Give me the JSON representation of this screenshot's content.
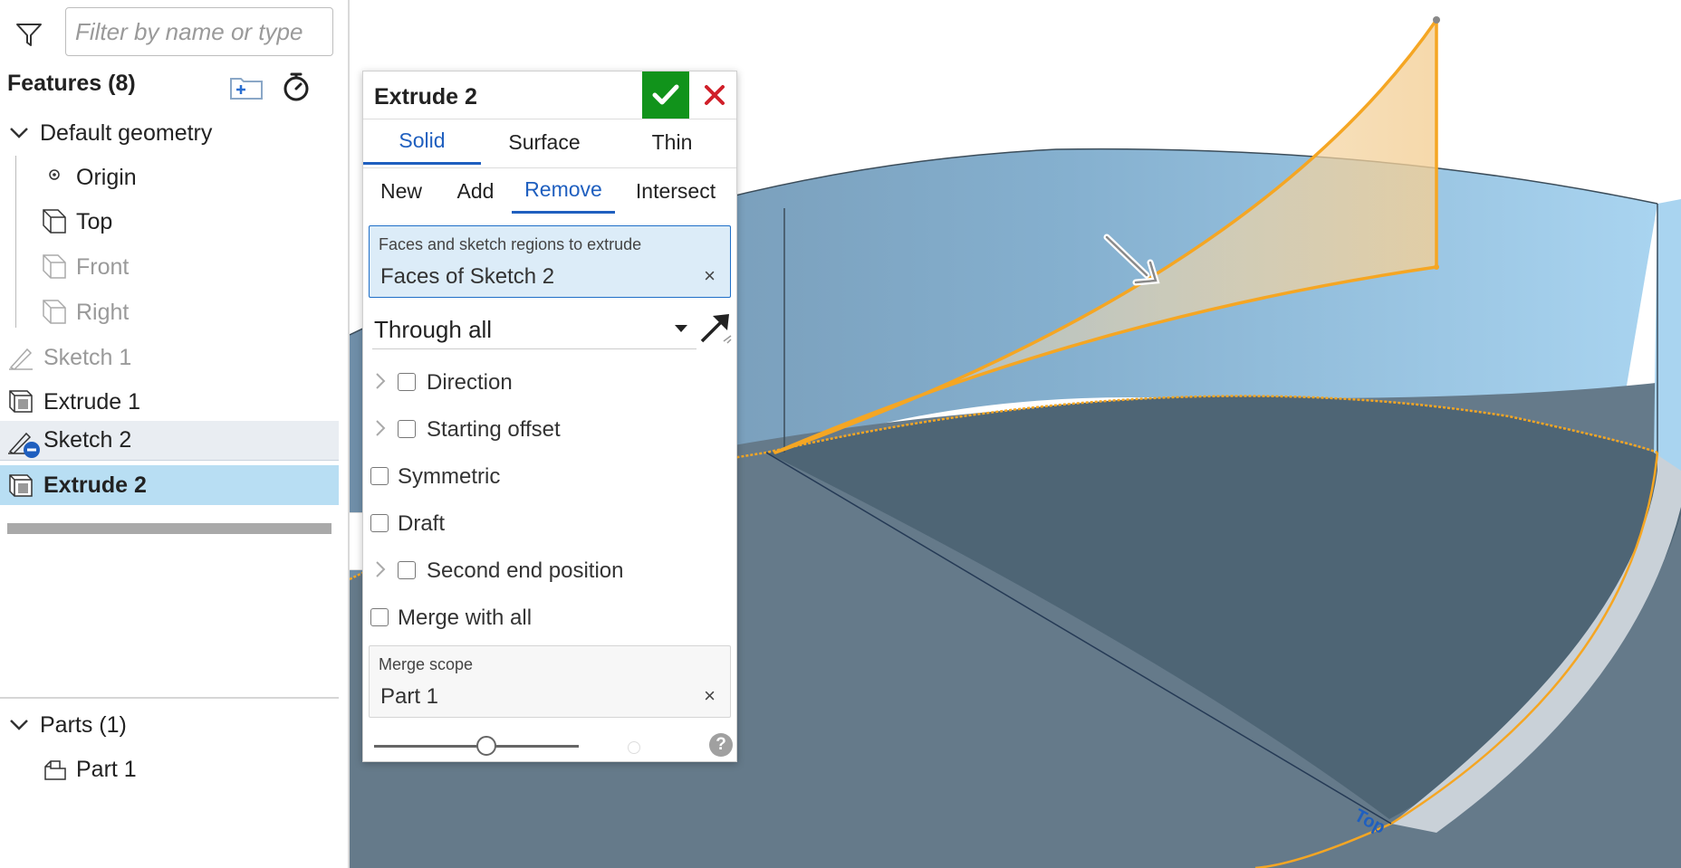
{
  "filter": {
    "placeholder": "Filter by name or type"
  },
  "features": {
    "heading": "Features (8)",
    "tree": [
      {
        "label": "Default geometry",
        "icon": "chevron-down-icon"
      },
      {
        "label": "Origin",
        "icon": "origin-icon"
      },
      {
        "label": "Top",
        "icon": "plane-icon"
      },
      {
        "label": "Front",
        "icon": "plane-icon",
        "state": "hidden"
      },
      {
        "label": "Right",
        "icon": "plane-icon",
        "state": "hidden"
      },
      {
        "label": "Sketch 1",
        "icon": "sketch-icon",
        "state": "hidden"
      },
      {
        "label": "Extrude 1",
        "icon": "extrude-icon"
      },
      {
        "label": "Sketch 2",
        "icon": "sketch-remove-icon",
        "state": "hover"
      },
      {
        "label": "Extrude 2",
        "icon": "extrude-icon",
        "state": "selected"
      }
    ]
  },
  "parts": {
    "heading": "Parts (1)",
    "items": [
      {
        "label": "Part 1",
        "icon": "part-icon"
      }
    ]
  },
  "dialog": {
    "title": "Extrude 2",
    "body_tabs": [
      "Solid",
      "Surface",
      "Thin"
    ],
    "body_tab_active": "Solid",
    "op_tabs": [
      "New",
      "Add",
      "Remove",
      "Intersect"
    ],
    "op_tab_active": "Remove",
    "selection": {
      "caption": "Faces and sketch regions to extrude",
      "value": "Faces of Sketch 2",
      "clear": "×"
    },
    "end_type": "Through all",
    "options": [
      {
        "label": "Direction",
        "expandable": true,
        "checked": false
      },
      {
        "label": "Starting offset",
        "expandable": true,
        "checked": false
      },
      {
        "label": "Symmetric",
        "expandable": false,
        "checked": false
      },
      {
        "label": "Draft",
        "expandable": false,
        "checked": false
      },
      {
        "label": "Second end position",
        "expandable": true,
        "checked": false
      },
      {
        "label": "Merge with all",
        "expandable": false,
        "checked": false
      }
    ],
    "merge_scope": {
      "caption": "Merge scope",
      "value": "Part 1",
      "clear": "×"
    },
    "help": "?",
    "slider_value": 0.55
  },
  "viewport": {
    "plane_label": "Top"
  },
  "colors": {
    "accent_blue": "#1f5fbf",
    "ok_green": "#11931b",
    "cancel_red": "#d0202a",
    "selection_row": "#b8def3",
    "sketch_orange": "#f5a623"
  }
}
